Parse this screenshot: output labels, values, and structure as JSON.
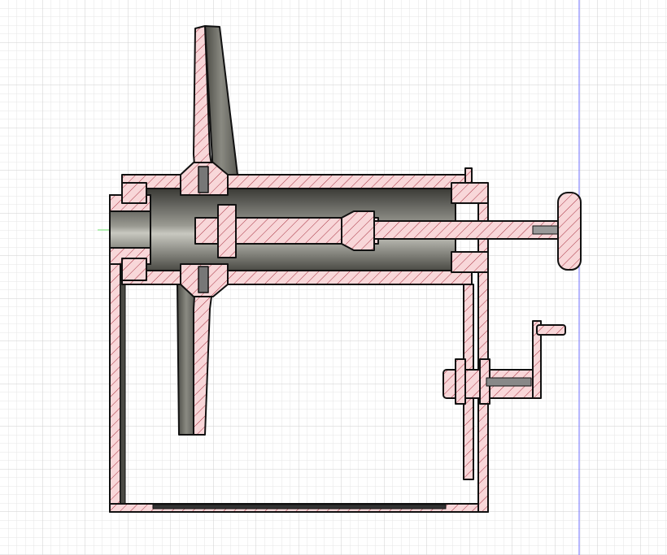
{
  "viewport": {
    "view": "section-analysis",
    "colors": {
      "background": "#ffffff",
      "grid_minor": "#e4e4e4",
      "grid_major": "#c8c8c8",
      "section_fill": "#f8d7d9",
      "hatch": "#b02a3a",
      "outline": "#111111",
      "axis_blue": "#6f6fff",
      "axis_green": "#66dd66"
    }
  }
}
